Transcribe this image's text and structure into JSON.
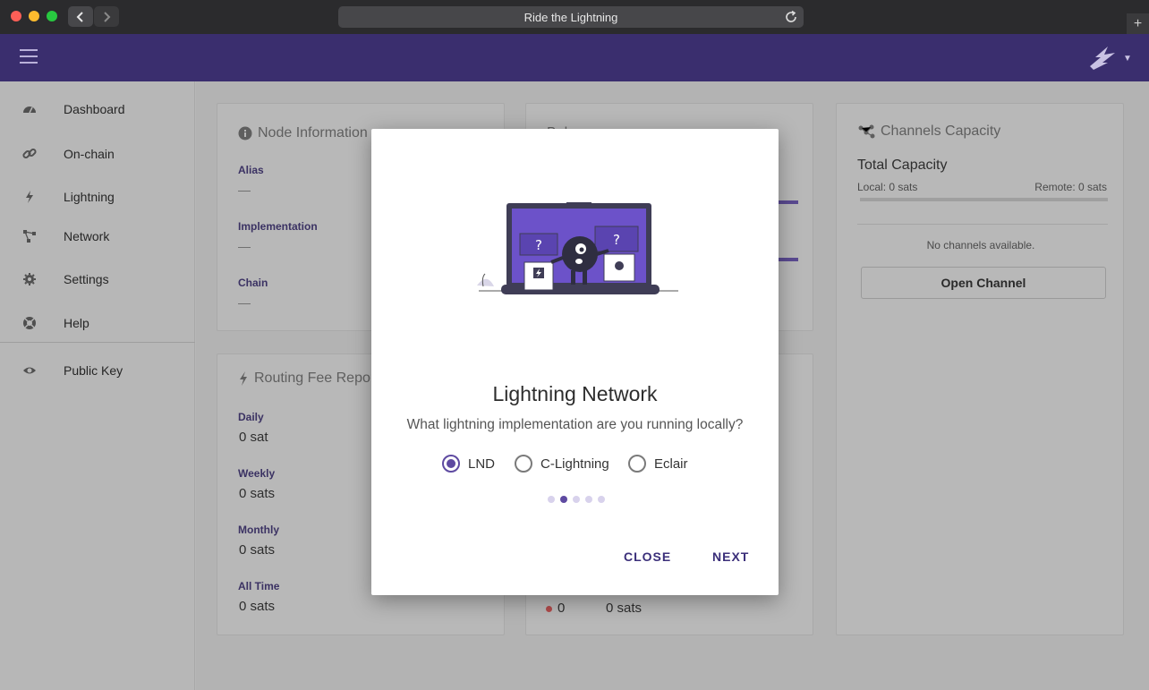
{
  "browser": {
    "url_title": "Ride the Lightning"
  },
  "sidebar": {
    "items": [
      {
        "label": "Dashboard",
        "icon": "dashboard-icon"
      },
      {
        "label": "On-chain",
        "icon": "link-icon"
      },
      {
        "label": "Lightning",
        "icon": "bolt-icon"
      },
      {
        "label": "Network",
        "icon": "network-icon"
      },
      {
        "label": "Settings",
        "icon": "gear-icon"
      },
      {
        "label": "Help",
        "icon": "help-icon"
      },
      {
        "label": "Public Key",
        "icon": "eye-icon"
      }
    ]
  },
  "node_info": {
    "title": "Node Information",
    "alias_label": "Alias",
    "alias_value": "—",
    "impl_label": "Implementation",
    "impl_value": "—",
    "chain_label": "Chain",
    "chain_value": "—"
  },
  "routing": {
    "title": "Routing Fee Report",
    "daily_label": "Daily",
    "daily_value": "0 sat",
    "weekly_label": "Weekly",
    "weekly_value": "0 sats",
    "monthly_label": "Monthly",
    "monthly_value": "0 sats",
    "alltime_label": "All Time",
    "alltime_value": "0 sats"
  },
  "balance_card": {
    "title_partial": "Bala",
    "count": "0",
    "amount": "0 sats"
  },
  "channels": {
    "title": "Channels Capacity",
    "total_label": "Total Capacity",
    "local": "Local: 0 sats",
    "remote": "Remote: 0 sats",
    "empty": "No channels available.",
    "open_button": "Open Channel"
  },
  "dialog": {
    "title": "Lightning Network",
    "subtitle": "What lightning implementation are you running locally?",
    "options": [
      "LND",
      "C-Lightning",
      "Eclair"
    ],
    "selected": "LND",
    "close": "CLOSE",
    "next": "NEXT",
    "step_current": 2,
    "step_total": 5
  },
  "colors": {
    "brand": "#5e4aa1",
    "topbar": "#3a2e6e"
  }
}
